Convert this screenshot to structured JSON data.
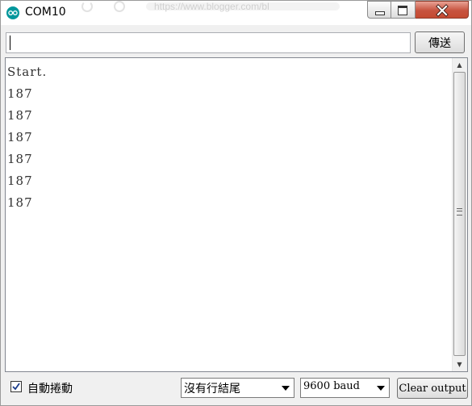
{
  "window": {
    "title": "COM10",
    "background_url_text": "https://www.blogger.com/bl"
  },
  "input": {
    "value": "",
    "send_label": "傳送"
  },
  "output": {
    "lines": [
      "Start.",
      "187",
      "187",
      "187",
      "187",
      "187",
      "187"
    ]
  },
  "footer": {
    "autoscroll_label": "自動捲動",
    "autoscroll_checked": true,
    "line_ending": "沒有行結尾",
    "baud_rate": "9600 baud",
    "clear_label": "Clear output"
  },
  "colors": {
    "app_icon": "#00979c",
    "close_button": "#c7533f"
  },
  "icons": {
    "app": "arduino-icon",
    "minimize": "minimize-icon",
    "maximize": "maximize-icon",
    "close": "close-icon",
    "scroll_up": "scroll-up-arrow",
    "scroll_down": "scroll-down-arrow",
    "checkmark": "checkmark-icon",
    "dropdown": "chevron-down-icon"
  }
}
